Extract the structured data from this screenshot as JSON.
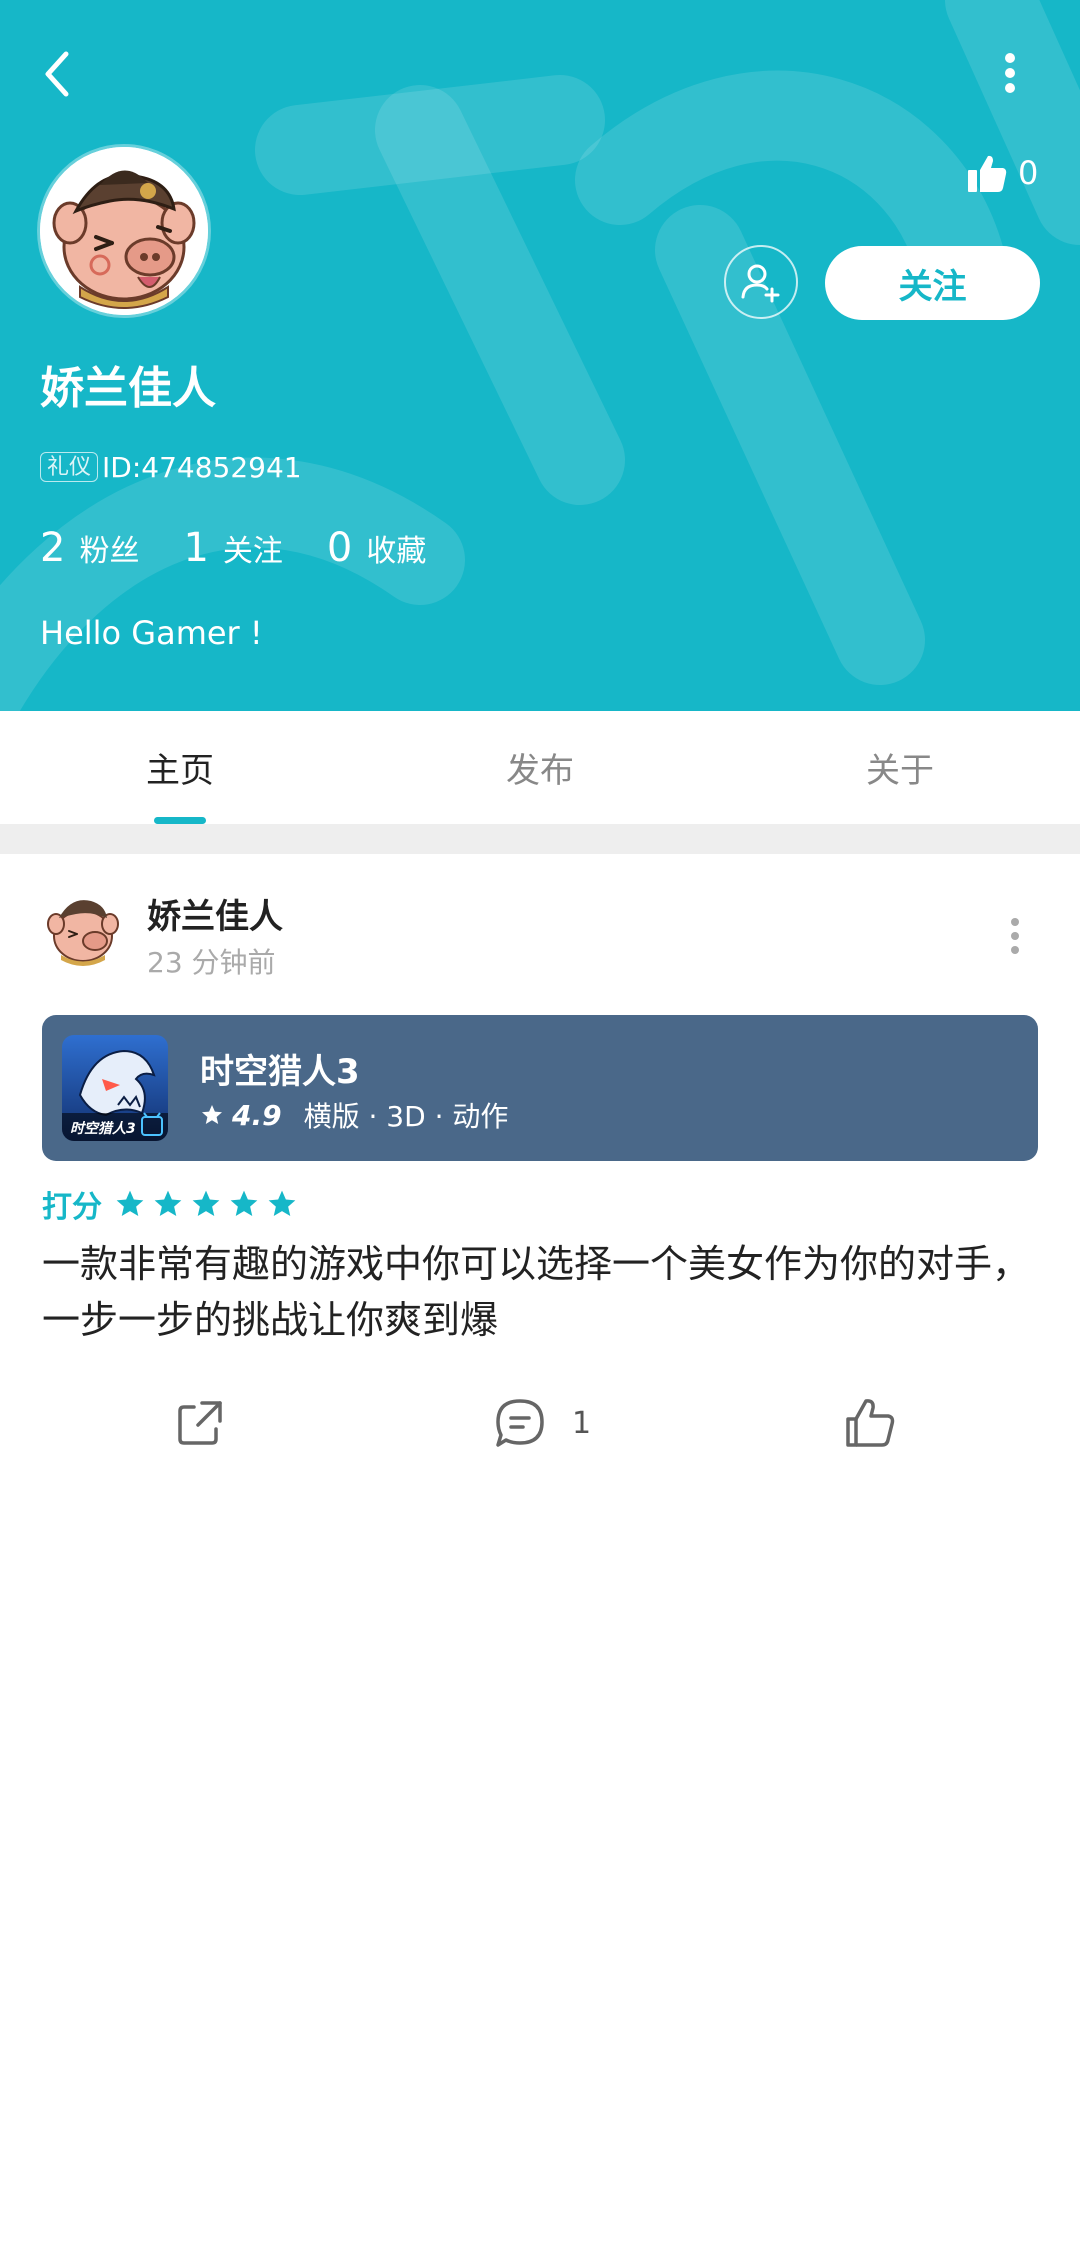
{
  "profile": {
    "like_count": "0",
    "follow_label": "关注",
    "username": "娇兰佳人",
    "tag": "礼仪",
    "id_text": "ID:474852941",
    "stats": [
      {
        "num": "2",
        "label": "粉丝"
      },
      {
        "num": "1",
        "label": "关注"
      },
      {
        "num": "0",
        "label": "收藏"
      }
    ],
    "bio": "Hello Gamer !"
  },
  "tabs": [
    {
      "label": "主页",
      "active": true
    },
    {
      "label": "发布",
      "active": false
    },
    {
      "label": "关于",
      "active": false
    }
  ],
  "post": {
    "author": "娇兰佳人",
    "time": "23 分钟前",
    "game": {
      "title": "时空猎人3",
      "rating": "4.9",
      "tags": "横版 · 3D · 动作",
      "icon_text": "时空猎人3"
    },
    "rate_label": "打分",
    "stars": 5,
    "text": "一款非常有趣的游戏中你可以选择一个美女作为你的对手，一步一步的挑战让你爽到爆",
    "comment_count": "1"
  },
  "colors": {
    "accent": "#16b7c8",
    "card": "#4a6889"
  }
}
